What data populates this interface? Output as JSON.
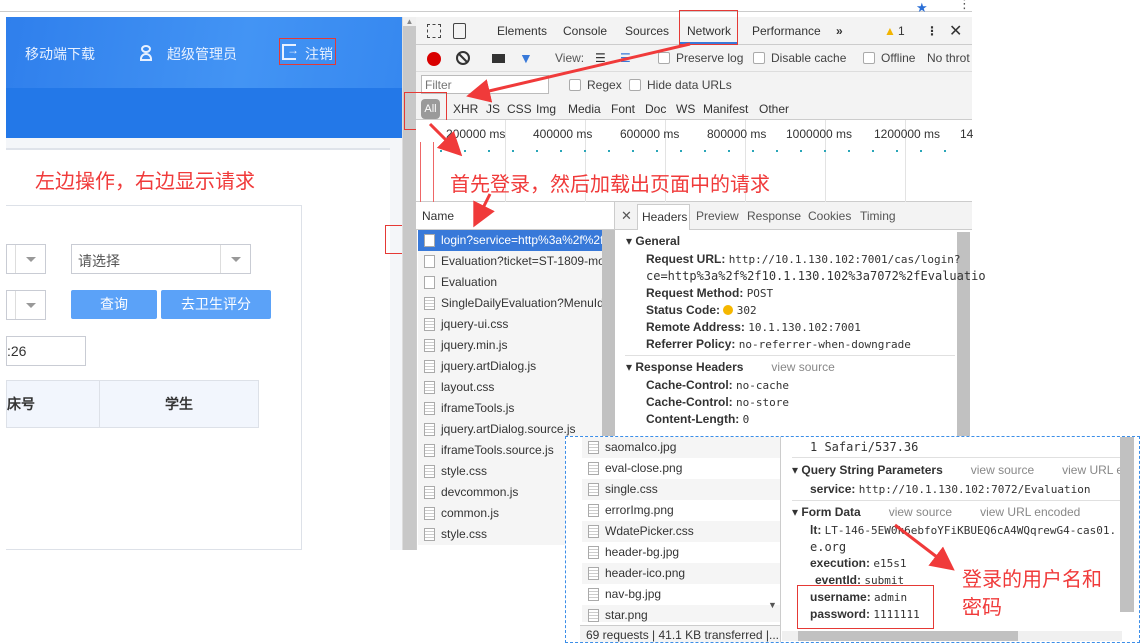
{
  "page": {
    "nav": {
      "mobile_download": "移动端下载",
      "user": "超级管理员",
      "logout": "注销"
    },
    "select_placeholder": "请选择",
    "query_button": "查询",
    "hygiene_button": "去卫生评分",
    "date_partial": ":26",
    "table_headers": [
      "床号",
      "学生"
    ]
  },
  "devtools": {
    "tabs": [
      "Elements",
      "Console",
      "Sources",
      "Network",
      "Performance"
    ],
    "more": "»",
    "warning_count": "1",
    "toolbar": {
      "view_label": "View:",
      "preserve_log": "Preserve log",
      "disable_cache": "Disable cache",
      "offline": "Offline",
      "throttle": "No throt"
    },
    "filter_placeholder": "Filter",
    "regex": "Regex",
    "hide_data_urls": "Hide data URLs",
    "types": [
      "All",
      "XHR",
      "JS",
      "CSS",
      "Img",
      "Media",
      "Font",
      "Doc",
      "WS",
      "Manifest",
      "Other"
    ],
    "timeline_ticks": [
      "200000 ms",
      "400000 ms",
      "600000 ms",
      "800000 ms",
      "1000000 ms",
      "1200000 ms",
      "14"
    ],
    "name_header": "Name",
    "detail_tabs": [
      "Headers",
      "Preview",
      "Response",
      "Cookies",
      "Timing"
    ],
    "requests": [
      "login?service=http%3a%2f%2f",
      "Evaluation?ticket=ST-1809-mo",
      "Evaluation",
      "SingleDailyEvaluation?MenuId",
      "jquery-ui.css",
      "jquery.min.js",
      "jquery.artDialog.js",
      "layout.css",
      "iframeTools.js",
      "jquery.artDialog.source.js",
      "iframeTools.source.js",
      "style.css",
      "devcommon.js",
      "common.js",
      "style.css"
    ],
    "general": {
      "title": "General",
      "request_url_label": "Request URL:",
      "request_url_1": "http://10.1.130.102:7001/cas/login?",
      "request_url_2": "ce=http%3a%2f%2f10.1.130.102%3a7072%2fEvaluatio",
      "method_label": "Request Method:",
      "method": "POST",
      "status_label": "Status Code:",
      "status": "302",
      "remote_label": "Remote Address:",
      "remote": "10.1.130.102:7001",
      "referrer_label": "Referrer Policy:",
      "referrer": "no-referrer-when-downgrade"
    },
    "response_headers": {
      "title": "Response Headers",
      "view_source": "view source",
      "cc_label": "Cache-Control:",
      "cc1": "no-cache",
      "cc2": "no-store",
      "cl_label": "Content-Length:",
      "cl": "0"
    }
  },
  "overlay": {
    "requests": [
      "saomaIco.jpg",
      "eval-close.png",
      "single.css",
      "errorImg.png",
      "WdatePicker.css",
      "header-bg.jpg",
      "header-ico.png",
      "nav-bg.jpg",
      "star.png"
    ],
    "summary": "69 requests  |  41.1 KB transferred  |...",
    "ua_tail": "1 Safari/537.36",
    "query": {
      "title": "Query String Parameters",
      "view_source": "view source",
      "view_url": "view URL e",
      "service_label": "service:",
      "service": "http://10.1.130.102:7072/Evaluation"
    },
    "form": {
      "title": "Form Data",
      "view_source": "view source",
      "view_url": "view URL encoded",
      "lt_label": "lt:",
      "lt": "LT-146-5EW0k6ebfoYFiKBUEQ6cA4WQqrewG4-cas01.",
      "lt2": "e.org",
      "execution_label": "execution:",
      "execution": "e15s1",
      "event_label": "eventId:",
      "event": "submit",
      "username_label": "username:",
      "username": "admin",
      "password_label": "password:",
      "password": "1111111"
    }
  },
  "annotations": {
    "left_note": "左边操作，右边显示请求",
    "first_login_note": "首先登录，然后加载出页面中的请求",
    "credentials_note_1": "登录的用户名和",
    "credentials_note_2": "密码"
  },
  "colors": {
    "accent": "#2378e8",
    "annotation": "#f03a3a",
    "selected_row": "#3879d9"
  }
}
